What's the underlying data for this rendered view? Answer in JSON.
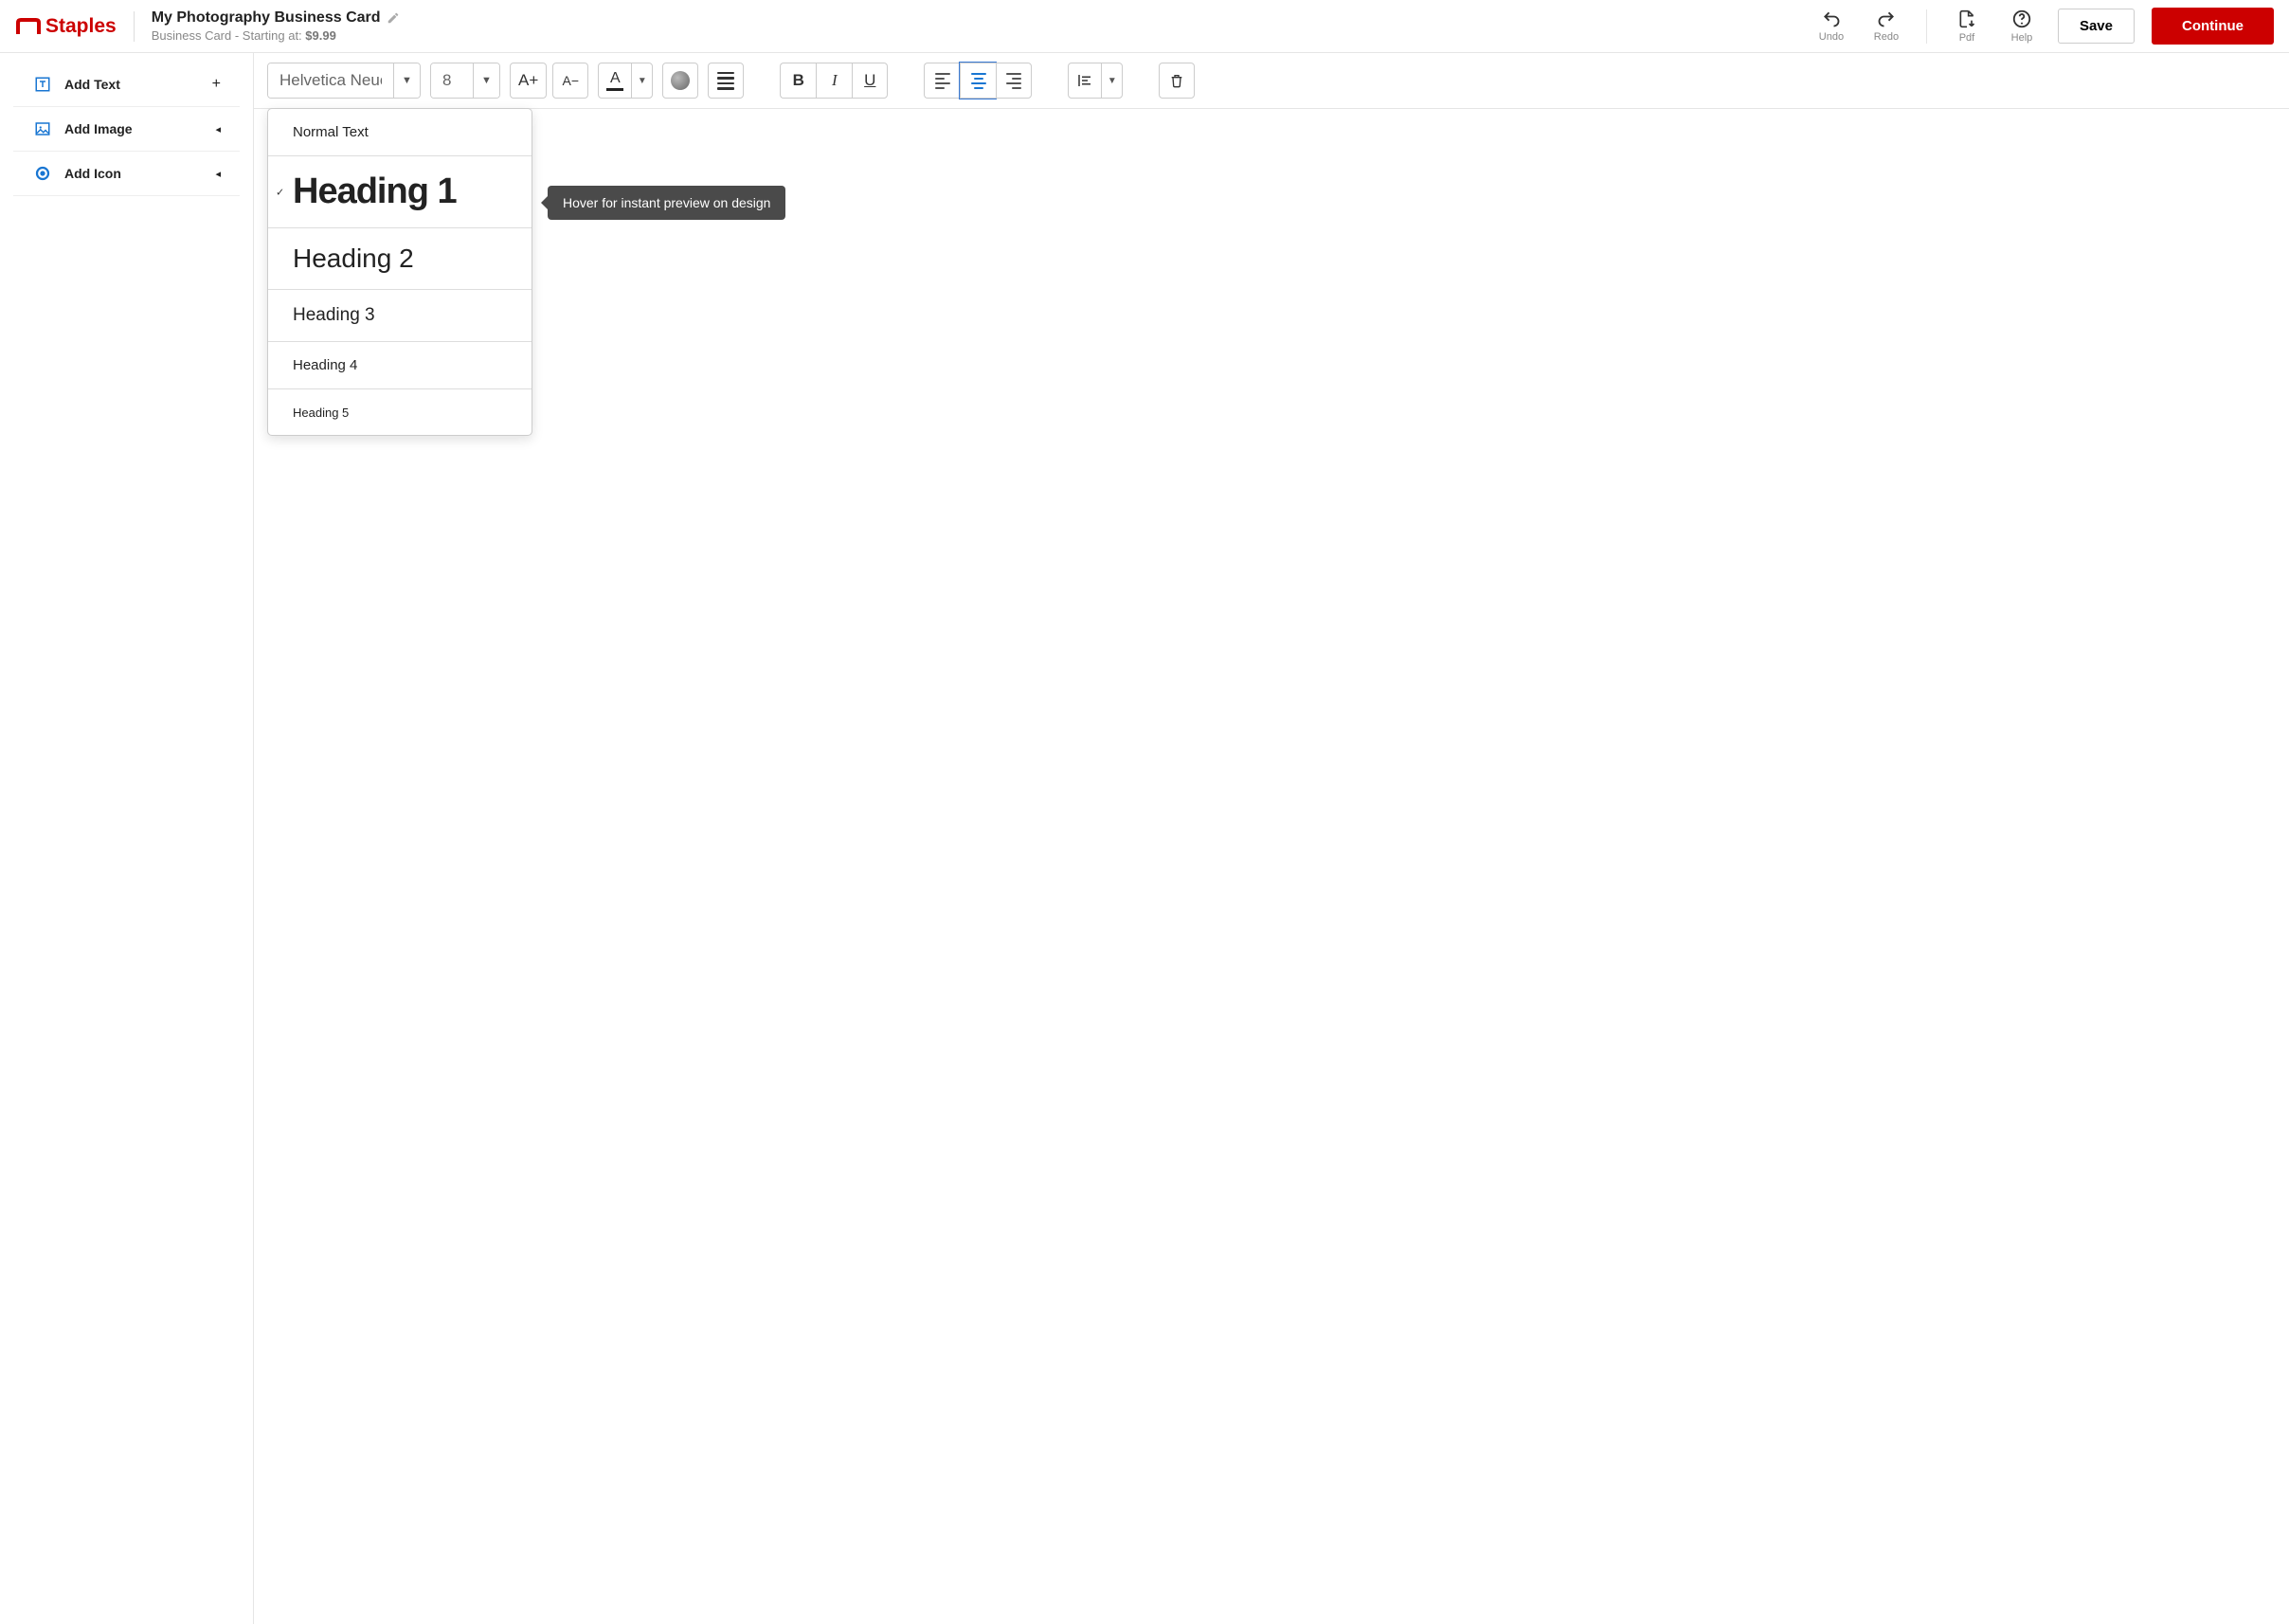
{
  "brand": {
    "name": "Staples"
  },
  "project": {
    "title": "My Photography Business Card",
    "subtitle_prefix": "Business Card - Starting at: ",
    "price": "$9.99"
  },
  "header_actions": {
    "undo": "Undo",
    "redo": "Redo",
    "pdf": "Pdf",
    "help": "Help",
    "save": "Save",
    "continue": "Continue"
  },
  "sidebar": {
    "items": [
      {
        "label": "Add Text",
        "tail": "+"
      },
      {
        "label": "Add Image",
        "tail": "◂"
      },
      {
        "label": "Add Icon",
        "tail": "◂"
      }
    ]
  },
  "toolbar": {
    "font_family": "Helvetica Neue",
    "font_size": "8",
    "increase": "A+",
    "decrease": "A−",
    "bold": "B",
    "italic": "I",
    "underline": "U"
  },
  "style_dropdown": {
    "options": [
      {
        "label": "Normal Text",
        "class": "dd-normal",
        "selected": false
      },
      {
        "label": "Heading 1",
        "class": "dd-h1",
        "selected": true
      },
      {
        "label": "Heading 2",
        "class": "dd-h2",
        "selected": false
      },
      {
        "label": "Heading 3",
        "class": "dd-h3",
        "selected": false
      },
      {
        "label": "Heading 4",
        "class": "dd-h4",
        "selected": false
      },
      {
        "label": "Heading 5",
        "class": "dd-h5",
        "selected": false
      }
    ]
  },
  "tooltip": {
    "text": "Hover for instant preview on design"
  }
}
